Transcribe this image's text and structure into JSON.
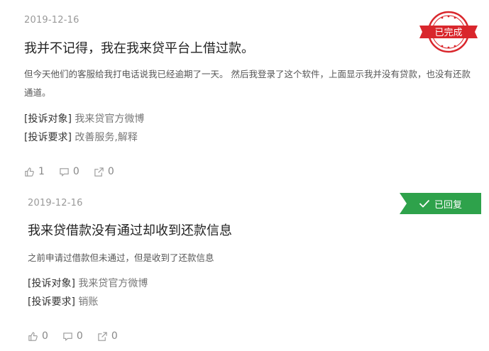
{
  "complaints": [
    {
      "date": "2019-12-16",
      "title": "我并不记得，我在我来贷平台上借过款。",
      "description": "但今天他们的客服给我打电话说我已经逾期了一天。 然后我登录了这个软件，上面显示我并没有贷款，也没有还款通道。",
      "target_label": "[投诉对象]",
      "target_value": "我来贷官方微博",
      "request_label": "[投诉要求]",
      "request_value": "改善服务,解释",
      "likes": "1",
      "comments": "0",
      "shares": "0",
      "status": "已完成",
      "status_color": "#d9262c"
    },
    {
      "date": "2019-12-16",
      "title": "我来贷借款没有通过却收到还款信息",
      "description": "之前申请过借款但未通过，但是收到了还款信息",
      "target_label": "[投诉对象]",
      "target_value": "我来贷官方微博",
      "request_label": "[投诉要求]",
      "request_value": "销账",
      "likes": "0",
      "comments": "0",
      "shares": "0",
      "status": "已回复",
      "status_color": "#2ea24b"
    }
  ],
  "icons": {
    "like": "thumbs-up-icon",
    "comment": "comment-icon",
    "share": "share-icon",
    "check": "check-icon"
  }
}
